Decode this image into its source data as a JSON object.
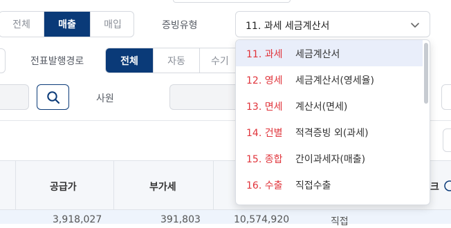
{
  "filters": {
    "trade_type": {
      "options": [
        "전체",
        "매출",
        "매입"
      ],
      "selected": "매출"
    },
    "evidence_type": {
      "label": "증빙유형",
      "value": "11. 과세 세금계산서"
    },
    "slip_route": {
      "label": "전표발행경로",
      "options": [
        "전체",
        "자동",
        "수기"
      ],
      "selected": "전체"
    },
    "employee": {
      "label": "사원"
    }
  },
  "dropdown": {
    "items": [
      {
        "code": "11. 과세",
        "name": "세금계산서",
        "selected": true
      },
      {
        "code": "12. 영세",
        "name": "세금계산서(영세율)"
      },
      {
        "code": "13. 면세",
        "name": "계산서(면세)"
      },
      {
        "code": "14. 건별",
        "name": "적격증빙 외(과세)"
      },
      {
        "code": "15. 종합",
        "name": "간이과세자(매출)"
      },
      {
        "code": "16. 수출",
        "name": "직접수출"
      }
    ]
  },
  "table": {
    "headers": [
      "공급가",
      "부가세",
      "크"
    ],
    "first_row_partial": [
      "3,918,027",
      "391,803",
      "10,574,920",
      "직접"
    ]
  },
  "icons": {
    "search": "search-icon",
    "chevron": "chevron-down-icon",
    "help": "help-circle-icon"
  },
  "colors": {
    "primary": "#0a3a78",
    "code_red": "#e0343b",
    "selected_bg": "#e9eefa"
  }
}
